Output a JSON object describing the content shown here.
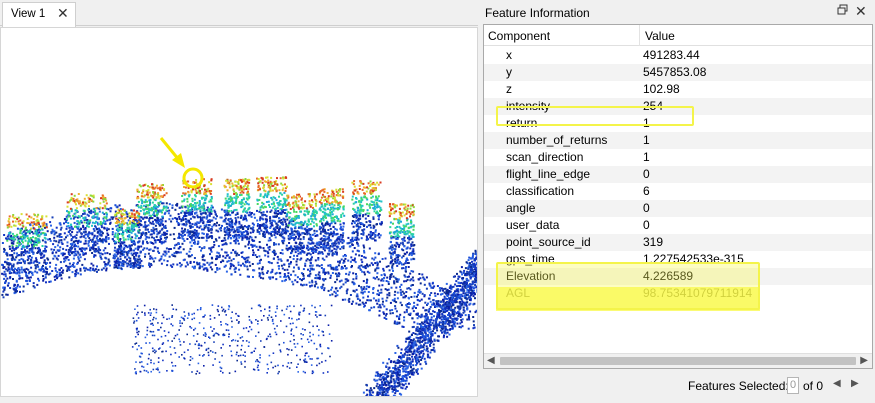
{
  "view": {
    "tab_label": "View 1",
    "close_glyph": "✕"
  },
  "panel": {
    "title": "Feature Information",
    "float_icon": "restore-icon",
    "close_glyph": "✕",
    "columns": [
      "Component",
      "Value"
    ],
    "rows": [
      {
        "component": "x",
        "value": "491283.44"
      },
      {
        "component": "y",
        "value": "5457853.08"
      },
      {
        "component": "z",
        "value": "102.98"
      },
      {
        "component": "intensity",
        "value": "254"
      },
      {
        "component": "return",
        "value": "1"
      },
      {
        "component": "number_of_returns",
        "value": "1"
      },
      {
        "component": "scan_direction",
        "value": "1"
      },
      {
        "component": "flight_line_edge",
        "value": "0"
      },
      {
        "component": "classification",
        "value": "6"
      },
      {
        "component": "angle",
        "value": "0"
      },
      {
        "component": "user_data",
        "value": "0"
      },
      {
        "component": "point_source_id",
        "value": "319"
      },
      {
        "component": "gps_time",
        "value": "1.227542533e-315"
      },
      {
        "component": "Elevation",
        "value": "4.226589"
      },
      {
        "component": "AGL",
        "value": "98.75341079711914"
      }
    ],
    "highlight_color": "#f4f44a"
  },
  "footer": {
    "features_label": "Features Selected:",
    "selected_value": "0",
    "of_text": "of 0",
    "prev_glyph": "◀",
    "next_glyph": "▶"
  },
  "annotation": {
    "arrow_color": "#f4e800"
  }
}
